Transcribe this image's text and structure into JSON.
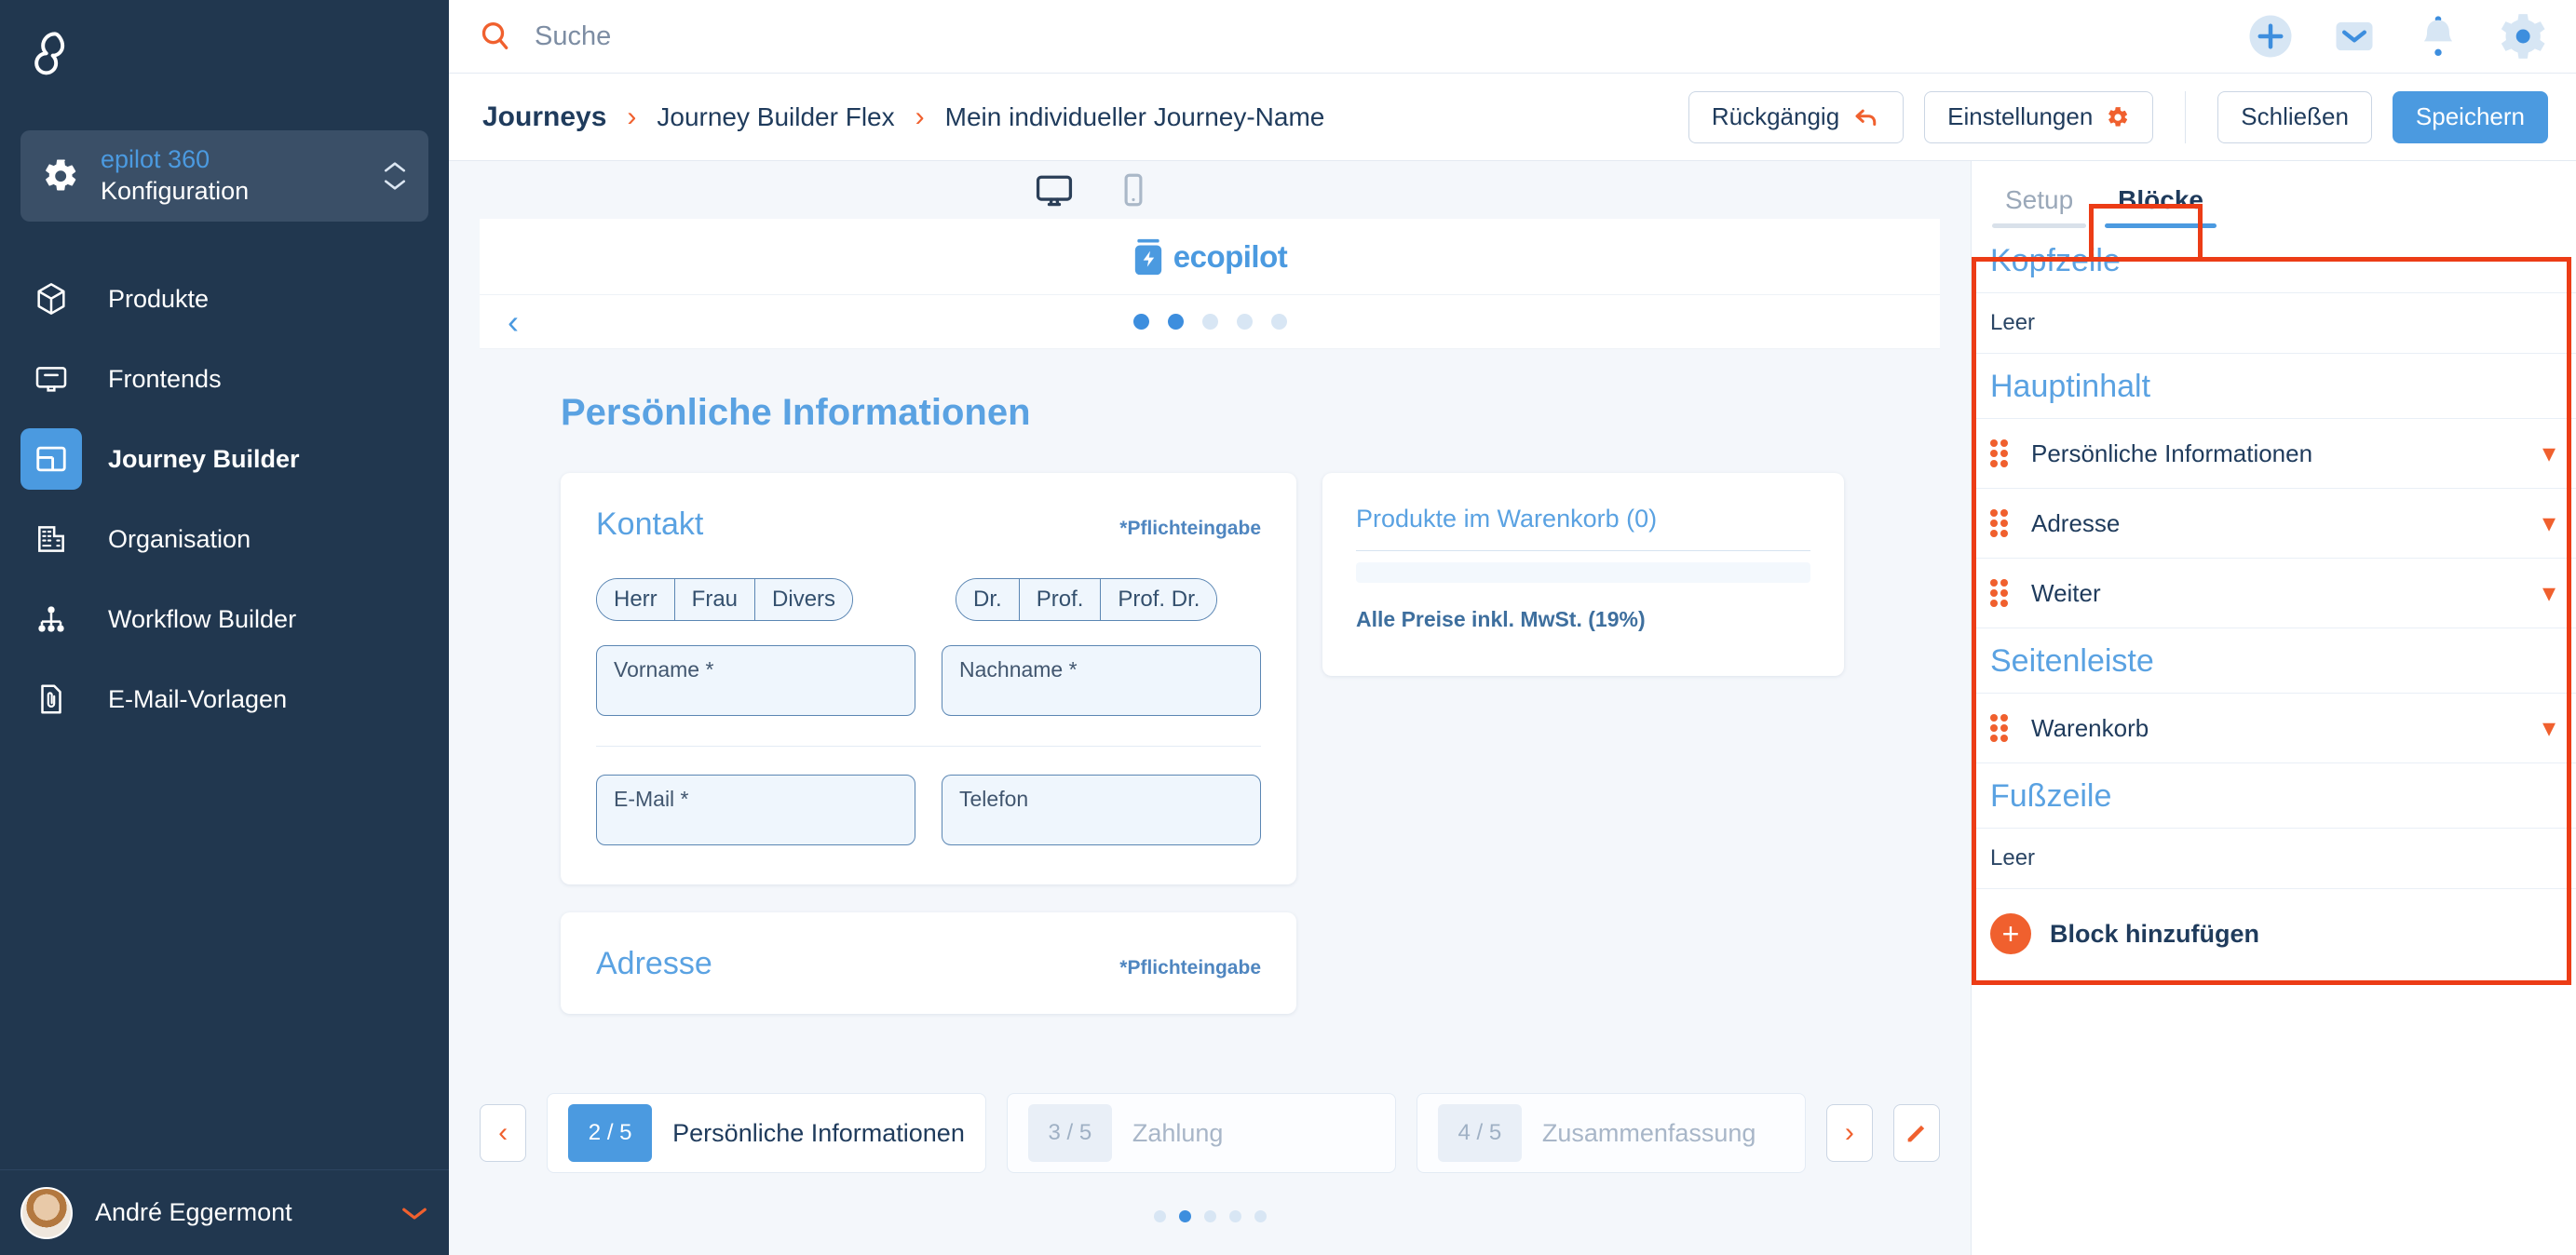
{
  "sidebar": {
    "org": {
      "name": "epilot 360",
      "sub": "Konfiguration"
    },
    "items": [
      {
        "label": "Produkte",
        "icon": "cube-icon"
      },
      {
        "label": "Frontends",
        "icon": "monitor-icon"
      },
      {
        "label": "Journey Builder",
        "icon": "layout-icon"
      },
      {
        "label": "Organisation",
        "icon": "building-icon"
      },
      {
        "label": "Workflow Builder",
        "icon": "workflow-icon"
      },
      {
        "label": "E-Mail-Vorlagen",
        "icon": "document-clip-icon"
      }
    ],
    "user": {
      "name": "André Eggermont"
    }
  },
  "topbar": {
    "search_placeholder": "Suche",
    "icons": [
      "plus-icon",
      "mail-icon",
      "bell-icon",
      "gear-icon"
    ]
  },
  "breadcrumb": {
    "items": [
      "Journeys",
      "Journey Builder Flex",
      "Mein individueller Journey-Name"
    ],
    "separator": "›"
  },
  "actions": {
    "undo": "Rückgängig",
    "settings": "Einstellungen",
    "close": "Schließen",
    "save": "Speichern"
  },
  "canvas": {
    "device_desktop": "desktop-icon",
    "device_mobile": "mobile-icon",
    "brand": "ecopilot",
    "carousel": {
      "total": 5,
      "active_index": 1
    },
    "section_title": "Persönliche Informationen",
    "kontakt": {
      "title": "Kontakt",
      "required_note": "*Pflichteingabe",
      "salutation_options": [
        "Herr",
        "Frau",
        "Divers"
      ],
      "title_options": [
        "Dr.",
        "Prof.",
        "Prof. Dr."
      ],
      "fields": [
        {
          "label": "Vorname *"
        },
        {
          "label": "Nachname *"
        },
        {
          "label": "E-Mail *"
        },
        {
          "label": "Telefon"
        }
      ]
    },
    "cart": {
      "title": "Produkte im Warenkorb (0)",
      "vat_note": "Alle Preise inkl. MwSt. (19%)"
    },
    "adresse": {
      "title": "Adresse",
      "required_note": "*Pflichteingabe"
    },
    "steps": {
      "prev_icon": "chevron-left-icon",
      "next_icon": "chevron-right-icon",
      "edit_icon": "pencil-icon",
      "items": [
        {
          "badge": "2 / 5",
          "label": "Persönliche Informationen",
          "active": true
        },
        {
          "badge": "3 / 5",
          "label": "Zahlung",
          "active": false
        },
        {
          "badge": "4 / 5",
          "label": "Zusammenfassung",
          "active": false
        }
      ],
      "dots_total": 5,
      "dots_active_index": 1
    }
  },
  "right_panel": {
    "tabs": [
      {
        "label": "Setup",
        "active": false
      },
      {
        "label": "Blöcke",
        "active": true
      }
    ],
    "groups": [
      {
        "title": "Kopfzeile",
        "empty_label": "Leer",
        "blocks": []
      },
      {
        "title": "Hauptinhalt",
        "blocks": [
          "Persönliche Informationen",
          "Adresse",
          "Weiter"
        ]
      },
      {
        "title": "Seitenleiste",
        "blocks": [
          "Warenkorb"
        ]
      },
      {
        "title": "Fußzeile",
        "empty_label": "Leer",
        "blocks": []
      }
    ],
    "add_block_label": "Block hinzufügen"
  },
  "colors": {
    "sidebar_bg": "#21374f",
    "accent_blue": "#4b9ae0",
    "accent_orange": "#f0602e",
    "highlight_red": "#ec3c16",
    "canvas_bg": "#f4f7fb"
  }
}
